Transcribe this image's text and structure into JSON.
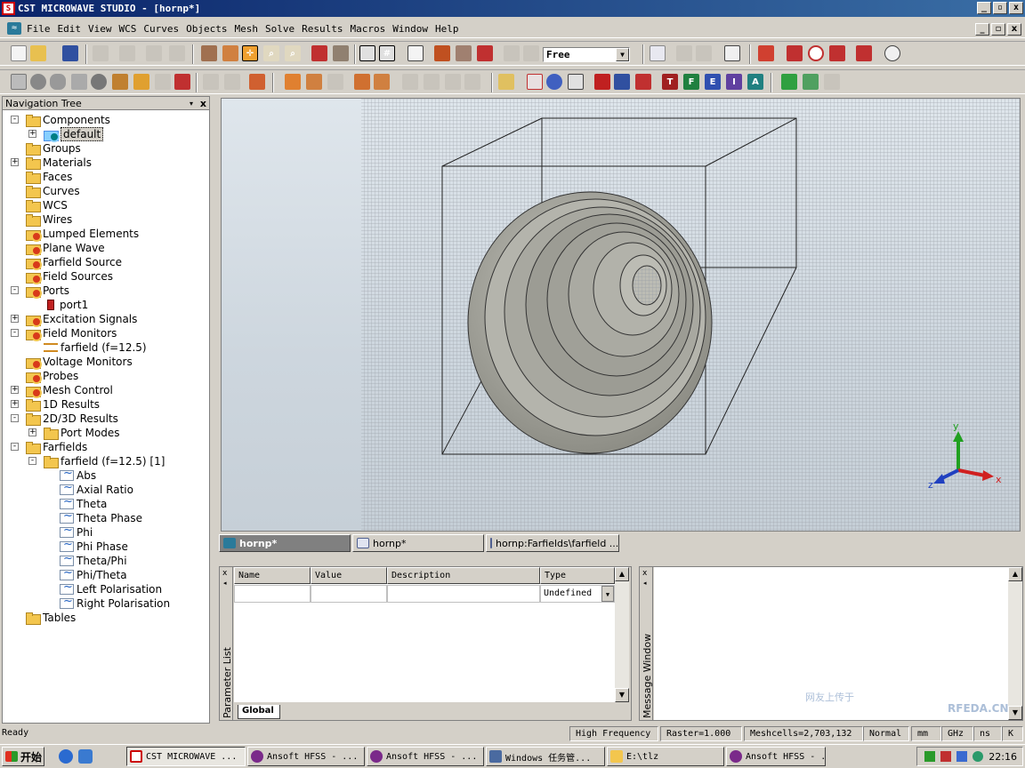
{
  "window": {
    "title": "CST MICROWAVE STUDIO - [hornp*]",
    "app_icon": "S",
    "min": "_",
    "max": "▫",
    "close": "x"
  },
  "menu": {
    "items": [
      "File",
      "Edit",
      "View",
      "WCS",
      "Curves",
      "Objects",
      "Mesh",
      "Solve",
      "Results",
      "Macros",
      "Window",
      "Help"
    ]
  },
  "toolbar": {
    "view_mode": "Free"
  },
  "nav": {
    "title": "Navigation Tree",
    "close": "x",
    "items": [
      {
        "label": "Components",
        "indent": 0,
        "expander": "-",
        "icon": "folder"
      },
      {
        "label": "default",
        "indent": 1,
        "expander": "+",
        "icon": "component",
        "selected": true
      },
      {
        "label": "Groups",
        "indent": 0,
        "expander": "",
        "icon": "folder"
      },
      {
        "label": "Materials",
        "indent": 0,
        "expander": "+",
        "icon": "folder"
      },
      {
        "label": "Faces",
        "indent": 0,
        "expander": "",
        "icon": "folder"
      },
      {
        "label": "Curves",
        "indent": 0,
        "expander": "",
        "icon": "folder"
      },
      {
        "label": "WCS",
        "indent": 0,
        "expander": "",
        "icon": "folder"
      },
      {
        "label": "Wires",
        "indent": 0,
        "expander": "",
        "icon": "folder"
      },
      {
        "label": "Lumped Elements",
        "indent": 0,
        "expander": "",
        "icon": "gear-folder"
      },
      {
        "label": "Plane Wave",
        "indent": 0,
        "expander": "",
        "icon": "gear-folder"
      },
      {
        "label": "Farfield Source",
        "indent": 0,
        "expander": "",
        "icon": "gear-folder"
      },
      {
        "label": "Field Sources",
        "indent": 0,
        "expander": "",
        "icon": "gear-folder"
      },
      {
        "label": "Ports",
        "indent": 0,
        "expander": "-",
        "icon": "gear-folder"
      },
      {
        "label": "port1",
        "indent": 1,
        "expander": "",
        "icon": "port"
      },
      {
        "label": "Excitation Signals",
        "indent": 0,
        "expander": "+",
        "icon": "gear-folder"
      },
      {
        "label": "Field Monitors",
        "indent": 0,
        "expander": "-",
        "icon": "gear-folder"
      },
      {
        "label": "farfield (f=12.5)",
        "indent": 1,
        "expander": "",
        "icon": "monitor"
      },
      {
        "label": "Voltage Monitors",
        "indent": 0,
        "expander": "",
        "icon": "gear-folder"
      },
      {
        "label": "Probes",
        "indent": 0,
        "expander": "",
        "icon": "gear-folder"
      },
      {
        "label": "Mesh Control",
        "indent": 0,
        "expander": "+",
        "icon": "gear-folder"
      },
      {
        "label": "1D Results",
        "indent": 0,
        "expander": "+",
        "icon": "folder"
      },
      {
        "label": "2D/3D Results",
        "indent": 0,
        "expander": "-",
        "icon": "folder"
      },
      {
        "label": "Port Modes",
        "indent": 1,
        "expander": "+",
        "icon": "folder"
      },
      {
        "label": "Farfields",
        "indent": 0,
        "expander": "-",
        "icon": "folder"
      },
      {
        "label": "farfield (f=12.5) [1]",
        "indent": 1,
        "expander": "-",
        "icon": "folder"
      },
      {
        "label": "Abs",
        "indent": 2,
        "expander": "",
        "icon": "wave"
      },
      {
        "label": "Axial Ratio",
        "indent": 2,
        "expander": "",
        "icon": "wave"
      },
      {
        "label": "Theta",
        "indent": 2,
        "expander": "",
        "icon": "wave"
      },
      {
        "label": "Theta Phase",
        "indent": 2,
        "expander": "",
        "icon": "wave"
      },
      {
        "label": "Phi",
        "indent": 2,
        "expander": "",
        "icon": "wave"
      },
      {
        "label": "Phi Phase",
        "indent": 2,
        "expander": "",
        "icon": "wave"
      },
      {
        "label": "Theta/Phi",
        "indent": 2,
        "expander": "",
        "icon": "wave"
      },
      {
        "label": "Phi/Theta",
        "indent": 2,
        "expander": "",
        "icon": "wave"
      },
      {
        "label": "Left Polarisation",
        "indent": 2,
        "expander": "",
        "icon": "wave"
      },
      {
        "label": "Right Polarisation",
        "indent": 2,
        "expander": "",
        "icon": "wave"
      },
      {
        "label": "Tables",
        "indent": 0,
        "expander": "",
        "icon": "folder"
      }
    ]
  },
  "viewport": {
    "axes": {
      "x": "x",
      "y": "y",
      "z": "z"
    }
  },
  "tabs": [
    {
      "label": "hornp*",
      "active": true
    },
    {
      "label": "hornp*",
      "active": false
    },
    {
      "label": "hornp:Farfields\\farfield ...",
      "active": false
    }
  ],
  "params": {
    "side_label": "Parameter List",
    "columns": [
      "Name",
      "Value",
      "Description",
      "Type"
    ],
    "row": {
      "name": "",
      "value": "",
      "description": "",
      "type": "Undefined"
    },
    "tab": "Global"
  },
  "messages": {
    "side_label": "Message Window"
  },
  "status": {
    "ready": "Ready",
    "solver": "High Frequency",
    "raster": "Raster=1.000",
    "meshcells": "Meshcells=2,703,132",
    "mode": "Normal",
    "unit_len": "mm",
    "unit_freq": "GHz",
    "unit_time": "ns",
    "unit_temp": "K"
  },
  "taskbar": {
    "start": "开始",
    "tasks": [
      "CST MICROWAVE ...",
      "Ansoft HFSS - ...",
      "Ansoft HFSS - ...",
      "Windows 任务管...",
      "E:\\tlz",
      "Ansoft HFSS - ..."
    ],
    "clock": "22:16"
  },
  "watermark": {
    "line1": "网友上传于",
    "line2": "RFEDA.CN"
  }
}
